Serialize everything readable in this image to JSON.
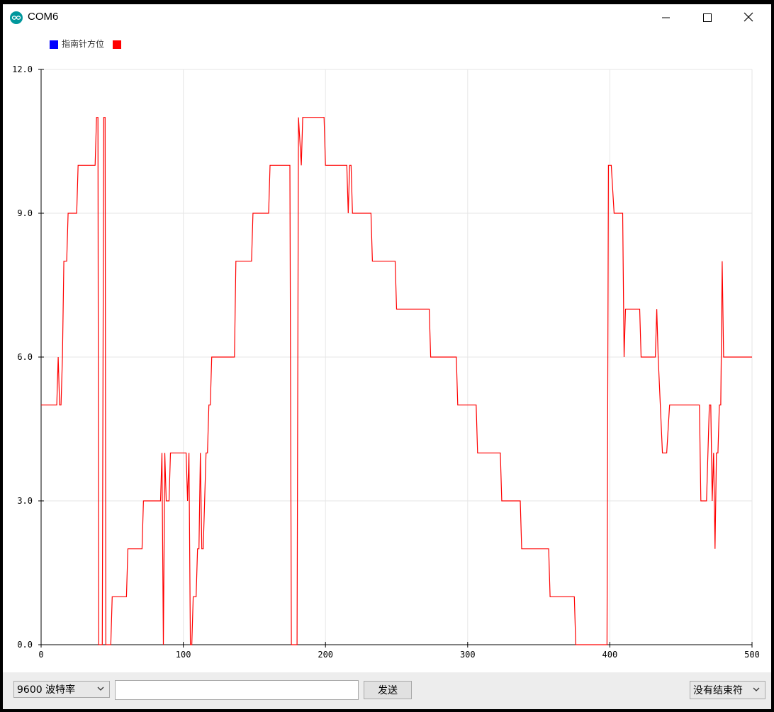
{
  "window": {
    "title": "COM6",
    "app_icon": "arduino-logo-icon",
    "controls": [
      "minimize-icon",
      "maximize-icon",
      "close-icon"
    ]
  },
  "legend": {
    "items": [
      {
        "label": "",
        "color": "#0000ff"
      },
      {
        "label": "指南针方位",
        "color": "#ff0000"
      }
    ]
  },
  "chart_data": {
    "type": "line",
    "title": "",
    "xlabel": "",
    "ylabel": "",
    "xlim": [
      0,
      500
    ],
    "ylim": [
      0,
      12
    ],
    "x_ticks": [
      "0",
      "100",
      "200",
      "300",
      "400",
      "500"
    ],
    "y_ticks": [
      "0.0",
      "3.0",
      "6.0",
      "9.0",
      "12.0"
    ],
    "grid": true,
    "series": [
      {
        "name": "指南针方位",
        "color": "#ff0000",
        "points": [
          [
            0,
            5
          ],
          [
            11,
            5
          ],
          [
            12,
            6
          ],
          [
            13,
            5
          ],
          [
            14,
            5
          ],
          [
            15,
            6
          ],
          [
            16,
            8
          ],
          [
            17,
            8
          ],
          [
            18,
            8
          ],
          [
            19,
            9
          ],
          [
            25,
            9
          ],
          [
            26,
            10
          ],
          [
            38,
            10
          ],
          [
            39,
            11
          ],
          [
            40,
            11
          ],
          [
            40.5,
            0
          ],
          [
            43,
            0
          ],
          [
            44,
            11
          ],
          [
            45,
            11
          ],
          [
            45.5,
            0
          ],
          [
            49,
            0
          ],
          [
            50,
            1
          ],
          [
            60,
            1
          ],
          [
            61,
            2
          ],
          [
            71,
            2
          ],
          [
            72,
            3
          ],
          [
            84,
            3
          ],
          [
            85,
            4
          ],
          [
            86,
            0
          ],
          [
            87,
            4
          ],
          [
            88,
            3
          ],
          [
            90,
            3
          ],
          [
            91,
            4
          ],
          [
            102,
            4
          ],
          [
            103,
            3
          ],
          [
            104,
            4
          ],
          [
            105,
            0
          ],
          [
            106,
            0
          ],
          [
            107,
            1
          ],
          [
            109,
            1
          ],
          [
            110,
            2
          ],
          [
            111,
            2
          ],
          [
            112,
            4
          ],
          [
            113,
            2
          ],
          [
            114,
            2
          ],
          [
            115,
            3
          ],
          [
            116,
            4
          ],
          [
            117,
            4
          ],
          [
            118,
            5
          ],
          [
            119,
            5
          ],
          [
            120,
            6
          ],
          [
            124,
            6
          ],
          [
            125,
            6
          ],
          [
            136,
            6
          ],
          [
            137,
            8
          ],
          [
            148,
            8
          ],
          [
            149,
            9
          ],
          [
            160,
            9
          ],
          [
            161,
            10
          ],
          [
            175,
            10
          ],
          [
            176,
            0
          ],
          [
            180,
            0
          ],
          [
            181,
            11
          ],
          [
            183,
            10
          ],
          [
            184,
            11
          ],
          [
            199,
            11
          ],
          [
            200,
            10
          ],
          [
            215,
            10
          ],
          [
            216,
            9
          ],
          [
            217,
            10
          ],
          [
            218,
            10
          ],
          [
            219,
            9
          ],
          [
            232,
            9
          ],
          [
            233,
            8
          ],
          [
            249,
            8
          ],
          [
            250,
            7
          ],
          [
            273,
            7
          ],
          [
            274,
            6
          ],
          [
            292,
            6
          ],
          [
            293,
            5
          ],
          [
            306,
            5
          ],
          [
            307,
            4
          ],
          [
            323,
            4
          ],
          [
            324,
            3
          ],
          [
            337,
            3
          ],
          [
            338,
            2
          ],
          [
            357,
            2
          ],
          [
            358,
            1
          ],
          [
            375,
            1
          ],
          [
            376,
            0
          ],
          [
            398,
            0
          ],
          [
            399,
            10
          ],
          [
            401,
            10
          ],
          [
            403,
            9
          ],
          [
            409,
            9
          ],
          [
            410,
            6
          ],
          [
            411,
            7
          ],
          [
            421,
            7
          ],
          [
            422,
            6
          ],
          [
            432,
            6
          ],
          [
            433,
            7
          ],
          [
            434,
            6
          ],
          [
            437,
            4
          ],
          [
            440,
            4
          ],
          [
            442,
            5
          ],
          [
            463,
            5
          ],
          [
            464,
            3
          ],
          [
            468,
            3
          ],
          [
            469,
            4
          ],
          [
            470,
            5
          ],
          [
            471,
            5
          ],
          [
            472,
            3
          ],
          [
            473,
            4
          ],
          [
            474,
            2
          ],
          [
            475,
            4
          ],
          [
            476,
            4
          ],
          [
            477,
            5
          ],
          [
            478,
            5
          ],
          [
            479,
            8
          ],
          [
            480,
            6
          ],
          [
            500,
            6
          ]
        ]
      }
    ]
  },
  "bottom": {
    "baud_rate": "9600 波特率",
    "send_input_value": "",
    "send_label": "发送",
    "line_ending": "没有结束符"
  }
}
